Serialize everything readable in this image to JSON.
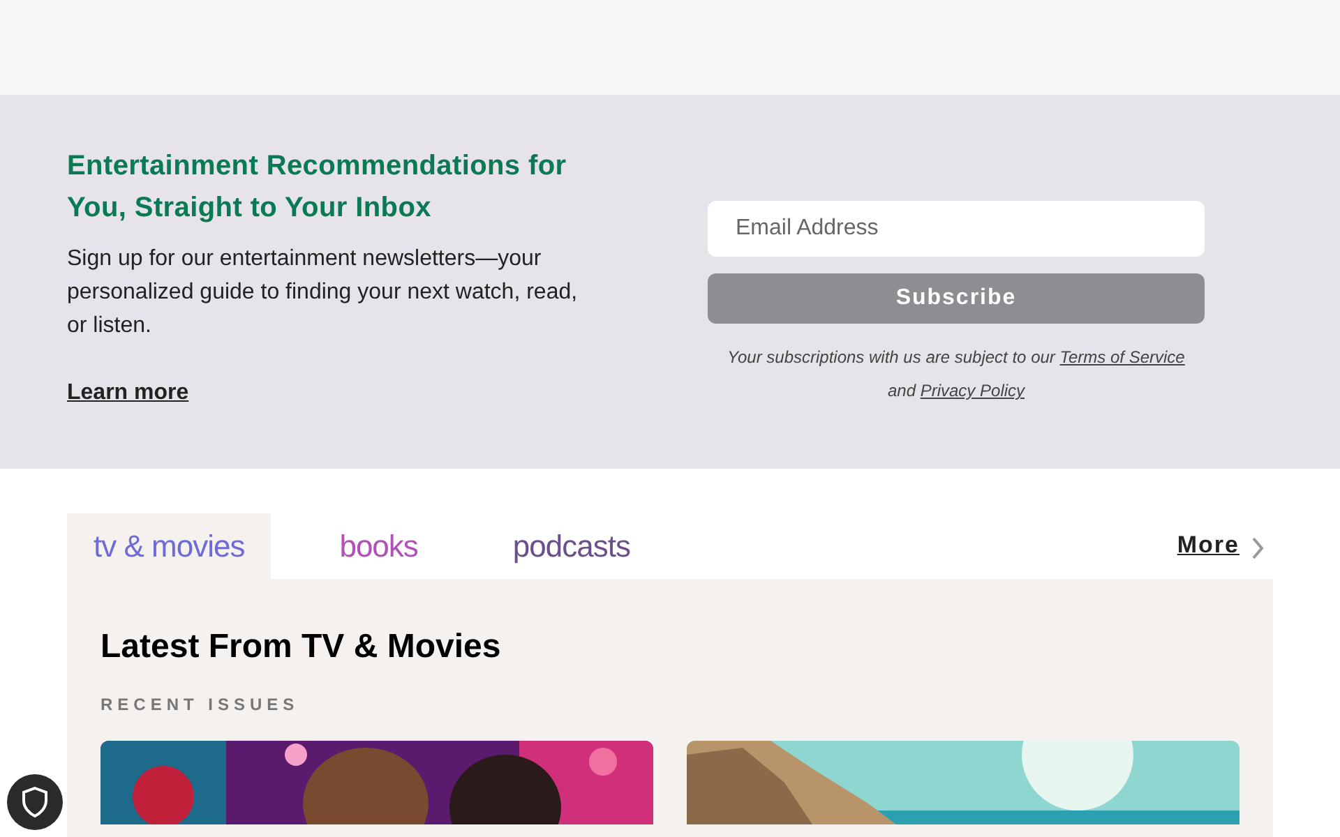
{
  "newsletter": {
    "heading": "Entertainment Recommendations for You, Straight to Your Inbox",
    "body": "Sign up for our entertainment newsletters—your personalized guide to finding your next watch, read, or listen.",
    "learn_more": "Learn more",
    "email": {
      "placeholder": "Email Address"
    },
    "subscribe": "Subscribe",
    "legal_before": "Your subscriptions with us are subject to our",
    "terms": "Terms of Service",
    "legal_and": "and",
    "privacy": "Privacy Policy"
  },
  "tabs": [
    {
      "label": "tv & movies",
      "selected": true,
      "color": "#6e6ad8"
    },
    {
      "label": "books",
      "selected": false,
      "color": "#b24fb8"
    },
    {
      "label": "podcasts",
      "selected": false,
      "color": "#6a4f8c"
    }
  ],
  "more": "More",
  "panel": {
    "title": "Latest From TV & Movies",
    "subtitle": "RECENT ISSUES"
  }
}
